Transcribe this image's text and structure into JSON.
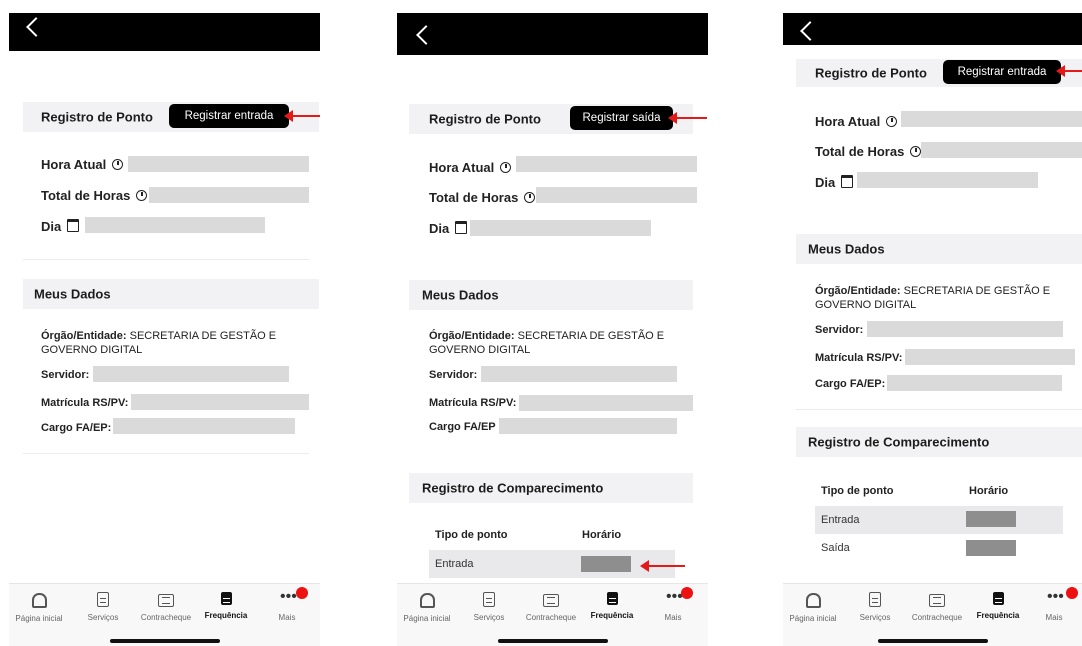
{
  "labels": {
    "registro_ponto": "Registro de Ponto",
    "hora_atual": "Hora Atual",
    "total_horas": "Total de Horas",
    "dia": "Dia",
    "meus_dados": "Meus Dados",
    "orgao_label": "Órgão/Entidade:",
    "orgao_value": "SECRETARIA DE GESTÃO E GOVERNO DIGITAL",
    "servidor": "Servidor:",
    "matricula": "Matrícula RS/PV:",
    "cargo": "Cargo FA/EP:",
    "cargo_alt": "Cargo FA/EP",
    "registro_comparecimento": "Registro de Comparecimento",
    "tipo_ponto": "Tipo de ponto",
    "horario": "Horário",
    "entrada": "Entrada",
    "saida": "Saída"
  },
  "buttons": {
    "registrar_entrada": "Registrar entrada",
    "registrar_saida": "Registrar saída"
  },
  "tabs": {
    "home": "Página inicial",
    "servicos": "Serviços",
    "contracheque": "Contracheque",
    "frequencia": "Frequência",
    "mais": "Mais"
  },
  "colors": {
    "accent_arrow": "#e21a1a",
    "button_bg": "#000000",
    "section_bg": "#f2f2f4",
    "badge": "#ee1111"
  },
  "icons": [
    "back-chevron-icon",
    "clock-icon",
    "calendar-icon",
    "home-icon",
    "services-icon",
    "paycheck-icon",
    "frequency-icon",
    "more-dots-icon"
  ]
}
